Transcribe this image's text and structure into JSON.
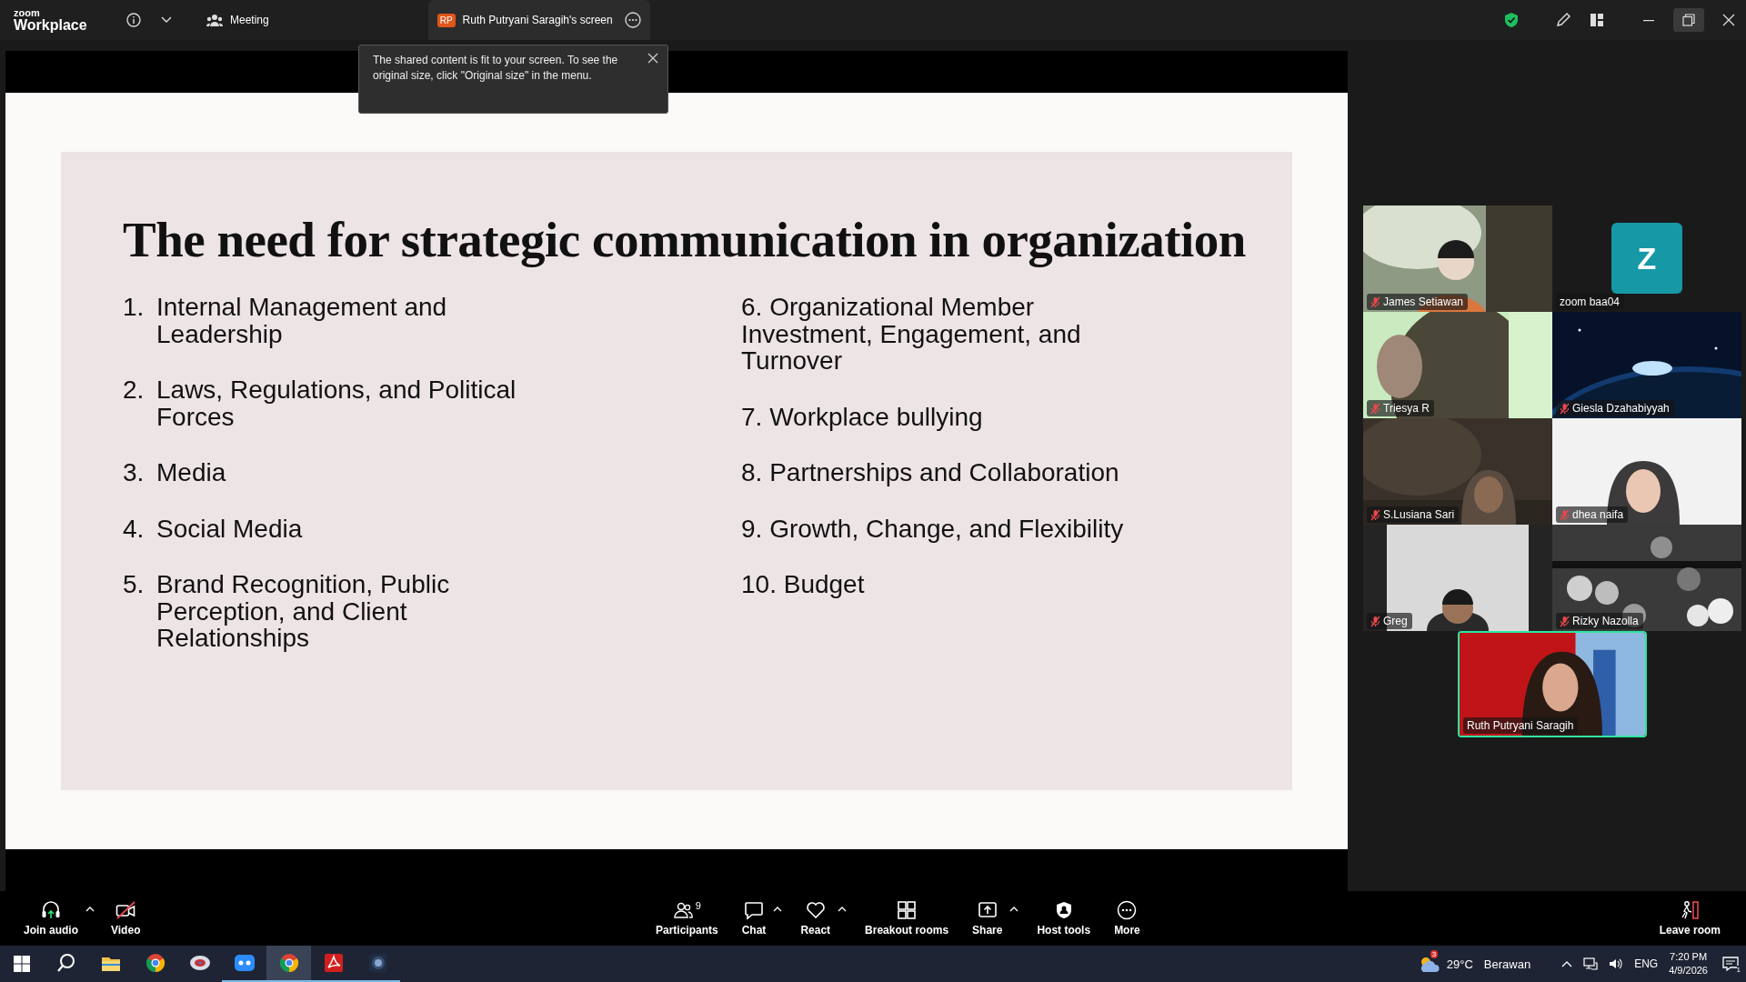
{
  "top_bar": {
    "logo_top": "zoom",
    "logo_bottom": "Workplace",
    "meeting_tab": "Meeting",
    "share_tab": {
      "initials": "RP",
      "label": "Ruth Putryani Saragih's screen",
      "selected": true
    }
  },
  "notice": "The shared content is fit to your screen. To see the original size, click \"Original size\" in the menu.",
  "slide": {
    "title": "The need for strategic communication in organization",
    "left_column": [
      {
        "number": "1.",
        "text": "Internal Management and Leadership"
      },
      {
        "number": "2.",
        "text": "Laws, Regulations, and Political Forces"
      },
      {
        "number": "3.",
        "text": "Media"
      },
      {
        "number": "4.",
        "text": "Social Media"
      },
      {
        "number": "5.",
        "text": "Brand Recognition, Public Perception, and Client Relationships"
      }
    ],
    "right_column": [
      {
        "text": "6. Organizational Member Investment, Engagement, and Turnover"
      },
      {
        "text": "7. Workplace bullying"
      },
      {
        "text": "8. Partnerships and Collaboration"
      },
      {
        "text": "9. Growth, Change, and Flexibility"
      },
      {
        "text": "10. Budget"
      }
    ]
  },
  "participants": [
    {
      "name": "James Setiawan",
      "kind": "video",
      "muted": true,
      "speaking": false
    },
    {
      "name": "zoom baa04",
      "kind": "avatar",
      "initial": "Z",
      "muted": false,
      "speaking": false
    },
    {
      "name": "Triesya R",
      "kind": "video",
      "muted": true,
      "speaking": false
    },
    {
      "name": "Giesla Dzahabiyyah",
      "kind": "video",
      "muted": true,
      "speaking": false
    },
    {
      "name": "S.Lusiana Sari",
      "kind": "video",
      "muted": true,
      "speaking": false
    },
    {
      "name": "dhea naifa",
      "kind": "video",
      "muted": true,
      "speaking": false
    },
    {
      "name": "Greg",
      "kind": "video",
      "muted": true,
      "speaking": false
    },
    {
      "name": "Rizky Nazolla",
      "kind": "video",
      "muted": true,
      "speaking": false
    },
    {
      "name": "Ruth Putryani Saragih",
      "kind": "video",
      "muted": false,
      "speaking": true
    }
  ],
  "toolbar": {
    "left": [
      {
        "kind": "audio",
        "label": "Join audio",
        "caret": true
      },
      {
        "kind": "video",
        "label": "Video",
        "caret": false,
        "off": true
      }
    ],
    "center": [
      {
        "kind": "participants",
        "label": "Participants",
        "count": "9",
        "caret": false
      },
      {
        "kind": "chat",
        "label": "Chat",
        "caret": true
      },
      {
        "kind": "react",
        "label": "React",
        "caret": true
      },
      {
        "kind": "breakout",
        "label": "Breakout rooms",
        "caret": false
      },
      {
        "kind": "share",
        "label": "Share",
        "caret": true
      },
      {
        "kind": "host",
        "label": "Host tools",
        "caret": false
      },
      {
        "kind": "more",
        "label": "More",
        "caret": false
      }
    ],
    "right": [
      {
        "kind": "leave",
        "label": "Leave room",
        "caret": false
      }
    ]
  },
  "taskbar": {
    "apps": [
      {
        "kind": "search",
        "running": false
      },
      {
        "kind": "folder",
        "running": false
      },
      {
        "kind": "chrome",
        "running": false
      },
      {
        "kind": "disc",
        "running": false
      },
      {
        "kind": "zoom",
        "running": true
      },
      {
        "kind": "chrome",
        "running": true,
        "selected": true
      },
      {
        "kind": "acrobat",
        "running": true
      },
      {
        "kind": "camera",
        "running": true
      }
    ],
    "weather": {
      "badge": "3",
      "temperature": "29°C",
      "condition": "Berawan"
    },
    "language": "ENG",
    "time": "7:20 PM",
    "date": "4/9/2026",
    "notifications": "1"
  }
}
